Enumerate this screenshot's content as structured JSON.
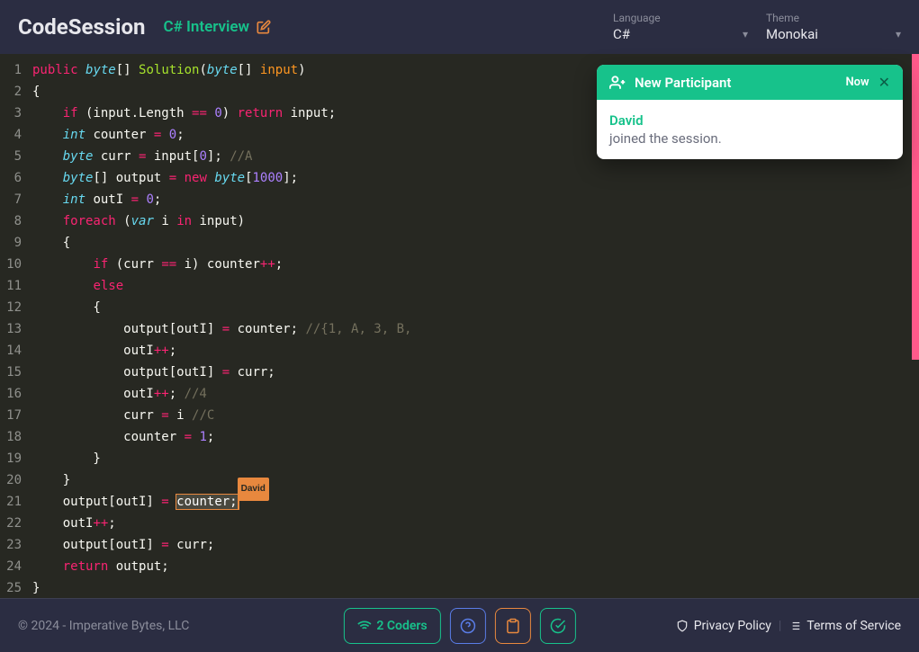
{
  "header": {
    "logo": "CodeSession",
    "session_name": "C# Interview",
    "language_label": "Language",
    "language_value": "C#",
    "theme_label": "Theme",
    "theme_value": "Monokai"
  },
  "toast": {
    "title": "New Participant",
    "time": "Now",
    "user": "David",
    "message": "joined the session."
  },
  "cursor": {
    "label": "David"
  },
  "code": {
    "lines": [
      [
        [
          "kw",
          "public"
        ],
        [
          "txt",
          " "
        ],
        [
          "type",
          "byte"
        ],
        [
          "txt",
          "[] "
        ],
        [
          "fn",
          "Solution"
        ],
        [
          "txt",
          "("
        ],
        [
          "type",
          "byte"
        ],
        [
          "txt",
          "[] "
        ],
        [
          "param",
          "input"
        ],
        [
          "txt",
          ")"
        ]
      ],
      [
        [
          "txt",
          "{"
        ]
      ],
      [
        [
          "txt",
          "    "
        ],
        [
          "kw",
          "if"
        ],
        [
          "txt",
          " (input.Length "
        ],
        [
          "kw",
          "=="
        ],
        [
          "txt",
          " "
        ],
        [
          "num",
          "0"
        ],
        [
          "txt",
          ") "
        ],
        [
          "kw",
          "return"
        ],
        [
          "txt",
          " input;"
        ]
      ],
      [
        [
          "txt",
          "    "
        ],
        [
          "type",
          "int"
        ],
        [
          "txt",
          " counter "
        ],
        [
          "kw",
          "="
        ],
        [
          "txt",
          " "
        ],
        [
          "num",
          "0"
        ],
        [
          "txt",
          ";"
        ]
      ],
      [
        [
          "txt",
          "    "
        ],
        [
          "type",
          "byte"
        ],
        [
          "txt",
          " curr "
        ],
        [
          "kw",
          "="
        ],
        [
          "txt",
          " input["
        ],
        [
          "num",
          "0"
        ],
        [
          "txt",
          "]; "
        ],
        [
          "com",
          "//A"
        ]
      ],
      [
        [
          "txt",
          "    "
        ],
        [
          "type",
          "byte"
        ],
        [
          "txt",
          "[] output "
        ],
        [
          "kw",
          "="
        ],
        [
          "txt",
          " "
        ],
        [
          "kw",
          "new"
        ],
        [
          "txt",
          " "
        ],
        [
          "type",
          "byte"
        ],
        [
          "txt",
          "["
        ],
        [
          "num",
          "1000"
        ],
        [
          "txt",
          "];"
        ]
      ],
      [
        [
          "txt",
          "    "
        ],
        [
          "type",
          "int"
        ],
        [
          "txt",
          " outI "
        ],
        [
          "kw",
          "="
        ],
        [
          "txt",
          " "
        ],
        [
          "num",
          "0"
        ],
        [
          "txt",
          ";"
        ]
      ],
      [
        [
          "txt",
          "    "
        ],
        [
          "kw",
          "foreach"
        ],
        [
          "txt",
          " ("
        ],
        [
          "type",
          "var"
        ],
        [
          "txt",
          " i "
        ],
        [
          "kw",
          "in"
        ],
        [
          "txt",
          " input)"
        ]
      ],
      [
        [
          "txt",
          "    {"
        ]
      ],
      [
        [
          "txt",
          "        "
        ],
        [
          "kw",
          "if"
        ],
        [
          "txt",
          " (curr "
        ],
        [
          "kw",
          "=="
        ],
        [
          "txt",
          " i) counter"
        ],
        [
          "kw",
          "++"
        ],
        [
          "txt",
          ";"
        ]
      ],
      [
        [
          "txt",
          "        "
        ],
        [
          "kw",
          "else"
        ]
      ],
      [
        [
          "txt",
          "        {"
        ]
      ],
      [
        [
          "txt",
          "            output[outI] "
        ],
        [
          "kw",
          "="
        ],
        [
          "txt",
          " counter; "
        ],
        [
          "com",
          "//{1, A, 3, B,"
        ]
      ],
      [
        [
          "txt",
          "            outI"
        ],
        [
          "kw",
          "++"
        ],
        [
          "txt",
          ";"
        ]
      ],
      [
        [
          "txt",
          "            output[outI] "
        ],
        [
          "kw",
          "="
        ],
        [
          "txt",
          " curr;"
        ]
      ],
      [
        [
          "txt",
          "            outI"
        ],
        [
          "kw",
          "++"
        ],
        [
          "txt",
          "; "
        ],
        [
          "com",
          "//4"
        ]
      ],
      [
        [
          "txt",
          "            curr "
        ],
        [
          "kw",
          "="
        ],
        [
          "txt",
          " i "
        ],
        [
          "com",
          "//C"
        ]
      ],
      [
        [
          "txt",
          "            counter "
        ],
        [
          "kw",
          "="
        ],
        [
          "txt",
          " "
        ],
        [
          "num",
          "1"
        ],
        [
          "txt",
          ";"
        ]
      ],
      [
        [
          "txt",
          "        }"
        ]
      ],
      [
        [
          "txt",
          "    }"
        ]
      ],
      [
        [
          "txt",
          "    output[outI] "
        ],
        [
          "kw",
          "="
        ],
        [
          "txt",
          " "
        ],
        [
          "sel",
          "counter;"
        ]
      ],
      [
        [
          "txt",
          "    outI"
        ],
        [
          "kw",
          "++"
        ],
        [
          "txt",
          ";"
        ]
      ],
      [
        [
          "txt",
          "    output[outI] "
        ],
        [
          "kw",
          "="
        ],
        [
          "txt",
          " curr;"
        ]
      ],
      [
        [
          "txt",
          "    "
        ],
        [
          "kw",
          "return"
        ],
        [
          "txt",
          " output;"
        ]
      ],
      [
        [
          "txt",
          "}"
        ]
      ]
    ]
  },
  "footer": {
    "copyright": "© 2024 - Imperative Bytes, LLC",
    "coders": "2 Coders",
    "privacy": "Privacy Policy",
    "terms": "Terms of Service"
  }
}
